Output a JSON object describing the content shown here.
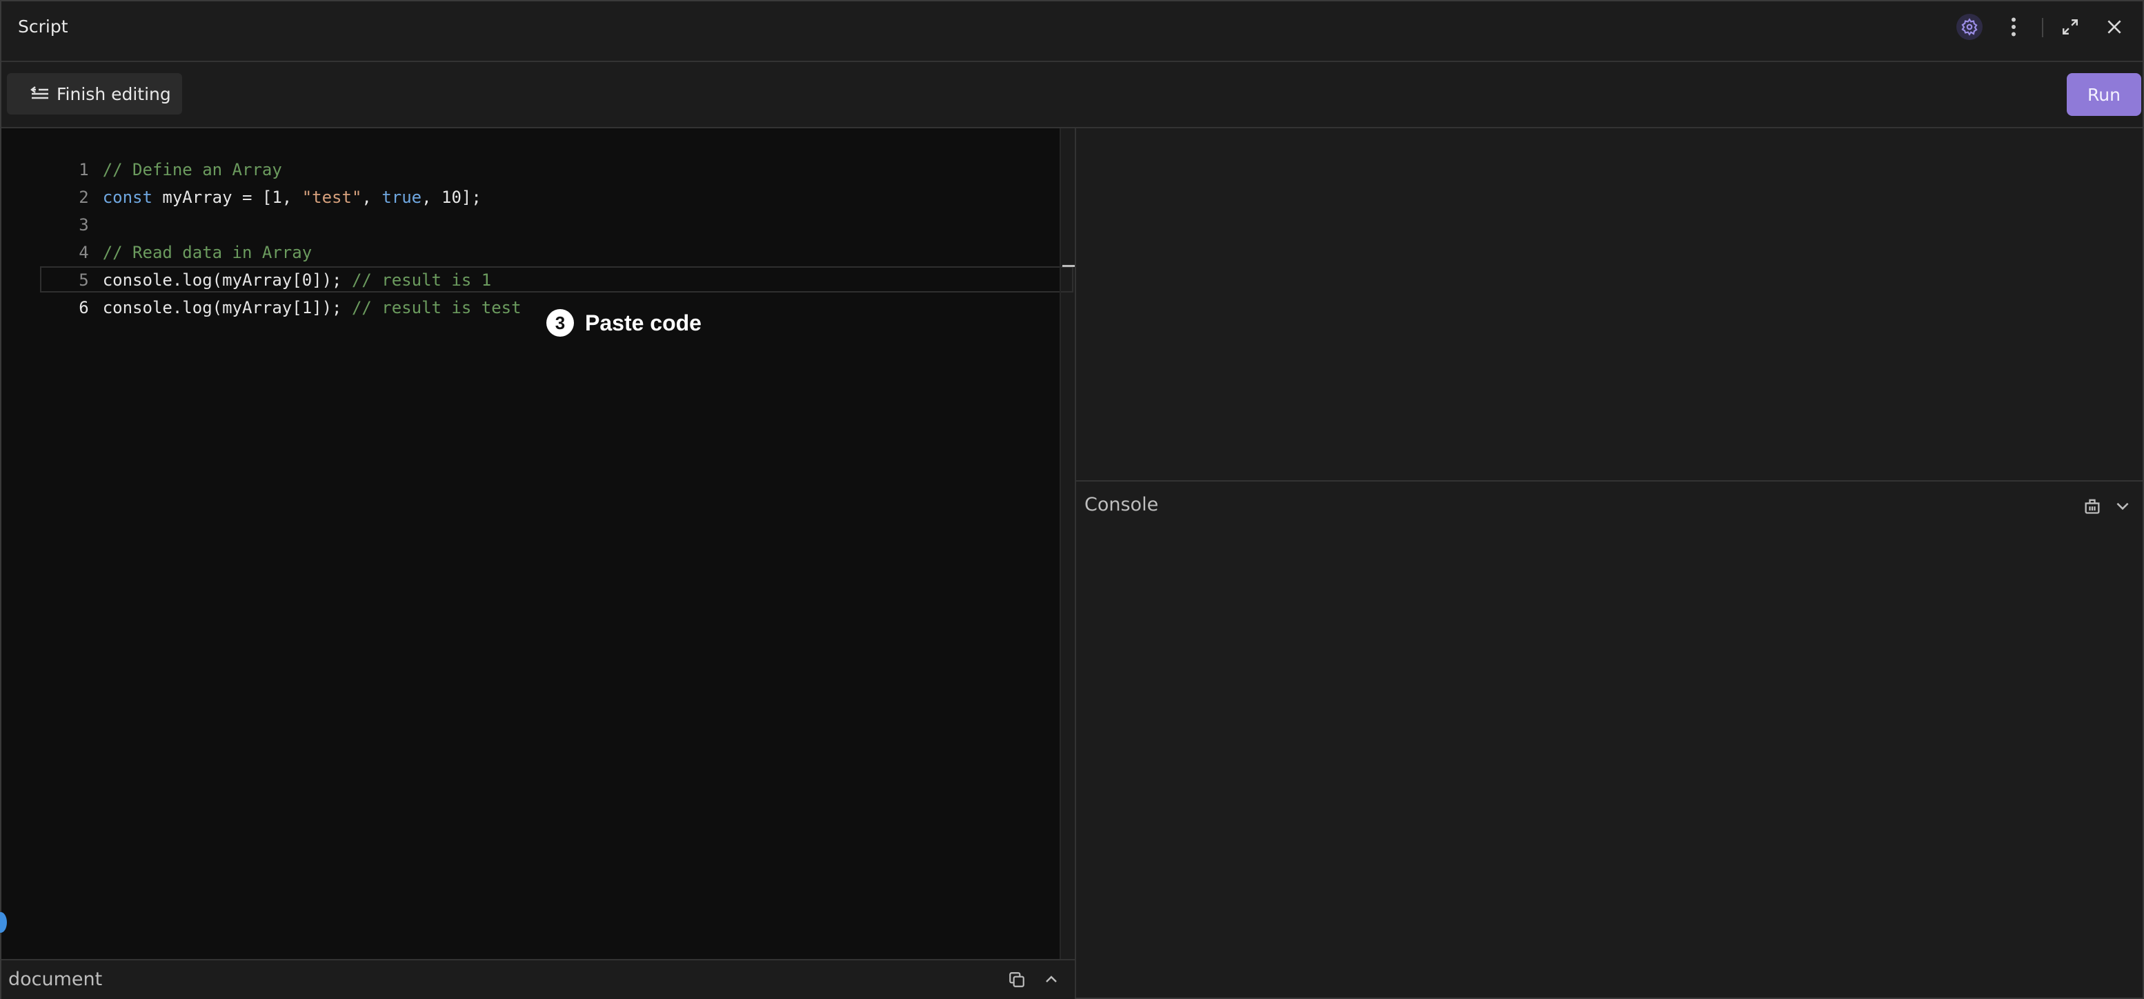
{
  "window": {
    "title": "Script",
    "icons": [
      "gear-icon",
      "more-vertical-icon",
      "expand-icon",
      "close-icon"
    ]
  },
  "toolbar": {
    "finish_label": "Finish editing",
    "run_label": "Run"
  },
  "editor": {
    "lines": [
      {
        "n": "1",
        "text": "// Define an Array"
      },
      {
        "n": "2",
        "text": "const myArray = [1, \"test\", true, 10];"
      },
      {
        "n": "3",
        "text": ""
      },
      {
        "n": "4",
        "text": "// Read data in Array"
      },
      {
        "n": "5",
        "text": "console.log(myArray[0]); // result is 1"
      },
      {
        "n": "6",
        "text": "console.log(myArray[1]); // result is test"
      }
    ],
    "active_line": 6
  },
  "tooltip": {
    "step": "3",
    "text": "Paste code"
  },
  "console": {
    "title": "Console"
  },
  "document_panel": {
    "title": "document"
  },
  "colors": {
    "accent": "#8f7ad8",
    "comment": "#6b9b5e",
    "keyword": "#6fa7e0",
    "string": "#d6a07c"
  }
}
